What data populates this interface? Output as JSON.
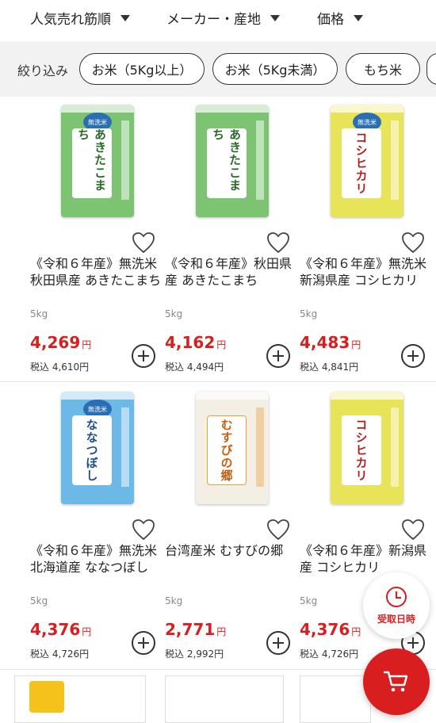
{
  "sort": {
    "popular": "人気売れ筋順",
    "maker": "メーカー・産地",
    "price": "価格"
  },
  "filter": {
    "label": "絞り込み",
    "chips": [
      "お米（5Kg以上）",
      "お米（5Kg未満）",
      "もち米"
    ]
  },
  "products": [
    {
      "title": "《令和６年産》無洗米 秋田県産 あきたこまち",
      "weight": "5kg",
      "price": "4,269",
      "yen": "円",
      "tax": "税込 4,610円",
      "bag_color": "#7cc472",
      "bag_label": "あきたこまち"
    },
    {
      "title": "《令和６年産》秋田県産 あきたこまち",
      "weight": "5kg",
      "price": "4,162",
      "yen": "円",
      "tax": "税込 4,494円",
      "bag_color": "#7cc472",
      "bag_label": "あきたこまち"
    },
    {
      "title": "《令和６年産》無洗米 新潟県産 コシヒカリ",
      "weight": "5kg",
      "price": "4,483",
      "yen": "円",
      "tax": "税込 4,841円",
      "bag_color": "#e8e45a",
      "bag_label": "コシヒカリ"
    },
    {
      "title": "《令和６年産》無洗米 北海道産 ななつぼし",
      "weight": "5kg",
      "price": "4,376",
      "yen": "円",
      "tax": "税込 4,726円",
      "bag_color": "#6cb8e6",
      "bag_label": "ななつぼし"
    },
    {
      "title": "台湾産米 むすびの郷",
      "weight": "5kg",
      "price": "2,771",
      "yen": "円",
      "tax": "税込 2,992円",
      "bag_color": "#f4efe4",
      "bag_label": "むすびの郷"
    },
    {
      "title": "《令和６年産》新潟県産 コシヒカリ",
      "weight": "5kg",
      "price": "4,376",
      "yen": "円",
      "tax": "税込 4,726円",
      "bag_color": "#e8e45a",
      "bag_label": "コシヒカリ"
    }
  ],
  "floating": {
    "pickup_label": "受取日時"
  },
  "colors": {
    "accent": "#d81e1e"
  }
}
